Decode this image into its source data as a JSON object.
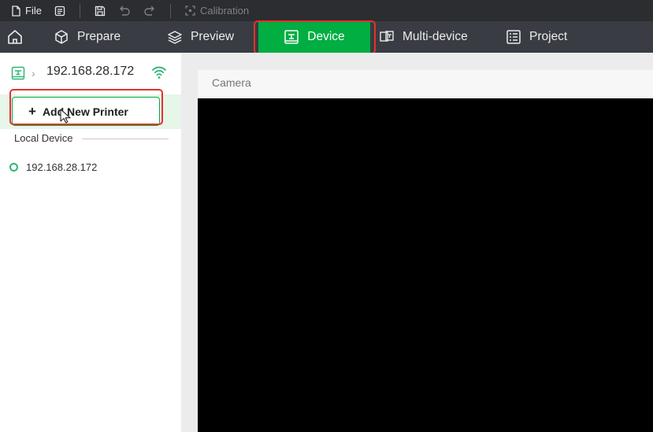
{
  "menubar": {
    "file_label": "File",
    "calibration_label": "Calibration"
  },
  "tabs": {
    "prepare": "Prepare",
    "preview": "Preview",
    "device": "Device",
    "multi_device": "Multi-device",
    "project": "Project"
  },
  "sidebar": {
    "current_device_ip": "192.168.28.172",
    "add_printer_plus": "+",
    "add_printer_label": "Add New Printer",
    "local_device_label": "Local Device",
    "local_devices": [
      {
        "ip": "192.168.28.172"
      }
    ]
  },
  "main": {
    "camera_title": "Camera"
  },
  "colors": {
    "accent": "#00ae42",
    "highlight": "#e4322b",
    "menubar_bg": "#2b2d31",
    "tabbar_bg": "#393c42"
  }
}
